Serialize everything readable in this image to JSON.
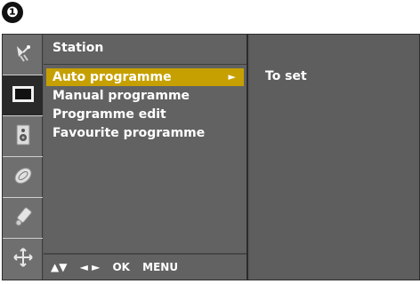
{
  "step_badge": "❶",
  "menu": {
    "title": "Station",
    "items": [
      {
        "label": "Auto programme",
        "selected": true,
        "arrow": "►"
      },
      {
        "label": "Manual programme",
        "selected": false
      },
      {
        "label": "Programme edit",
        "selected": false
      },
      {
        "label": "Favourite programme",
        "selected": false
      }
    ]
  },
  "sidebar_icons": [
    {
      "name": "station-icon",
      "active": false
    },
    {
      "name": "picture-icon",
      "active": true
    },
    {
      "name": "sound-icon",
      "active": false
    },
    {
      "name": "time-icon",
      "active": false
    },
    {
      "name": "special-icon",
      "active": false
    },
    {
      "name": "screen-icon",
      "active": false
    }
  ],
  "footer": {
    "nav_up_down": "▲▼",
    "nav_left_right": "◄ ►",
    "ok": "OK",
    "menu": "MENU"
  },
  "info": {
    "text": "To set"
  },
  "colors": {
    "highlight": "#c6a000",
    "panel": "#626262",
    "text": "#ffffff"
  }
}
